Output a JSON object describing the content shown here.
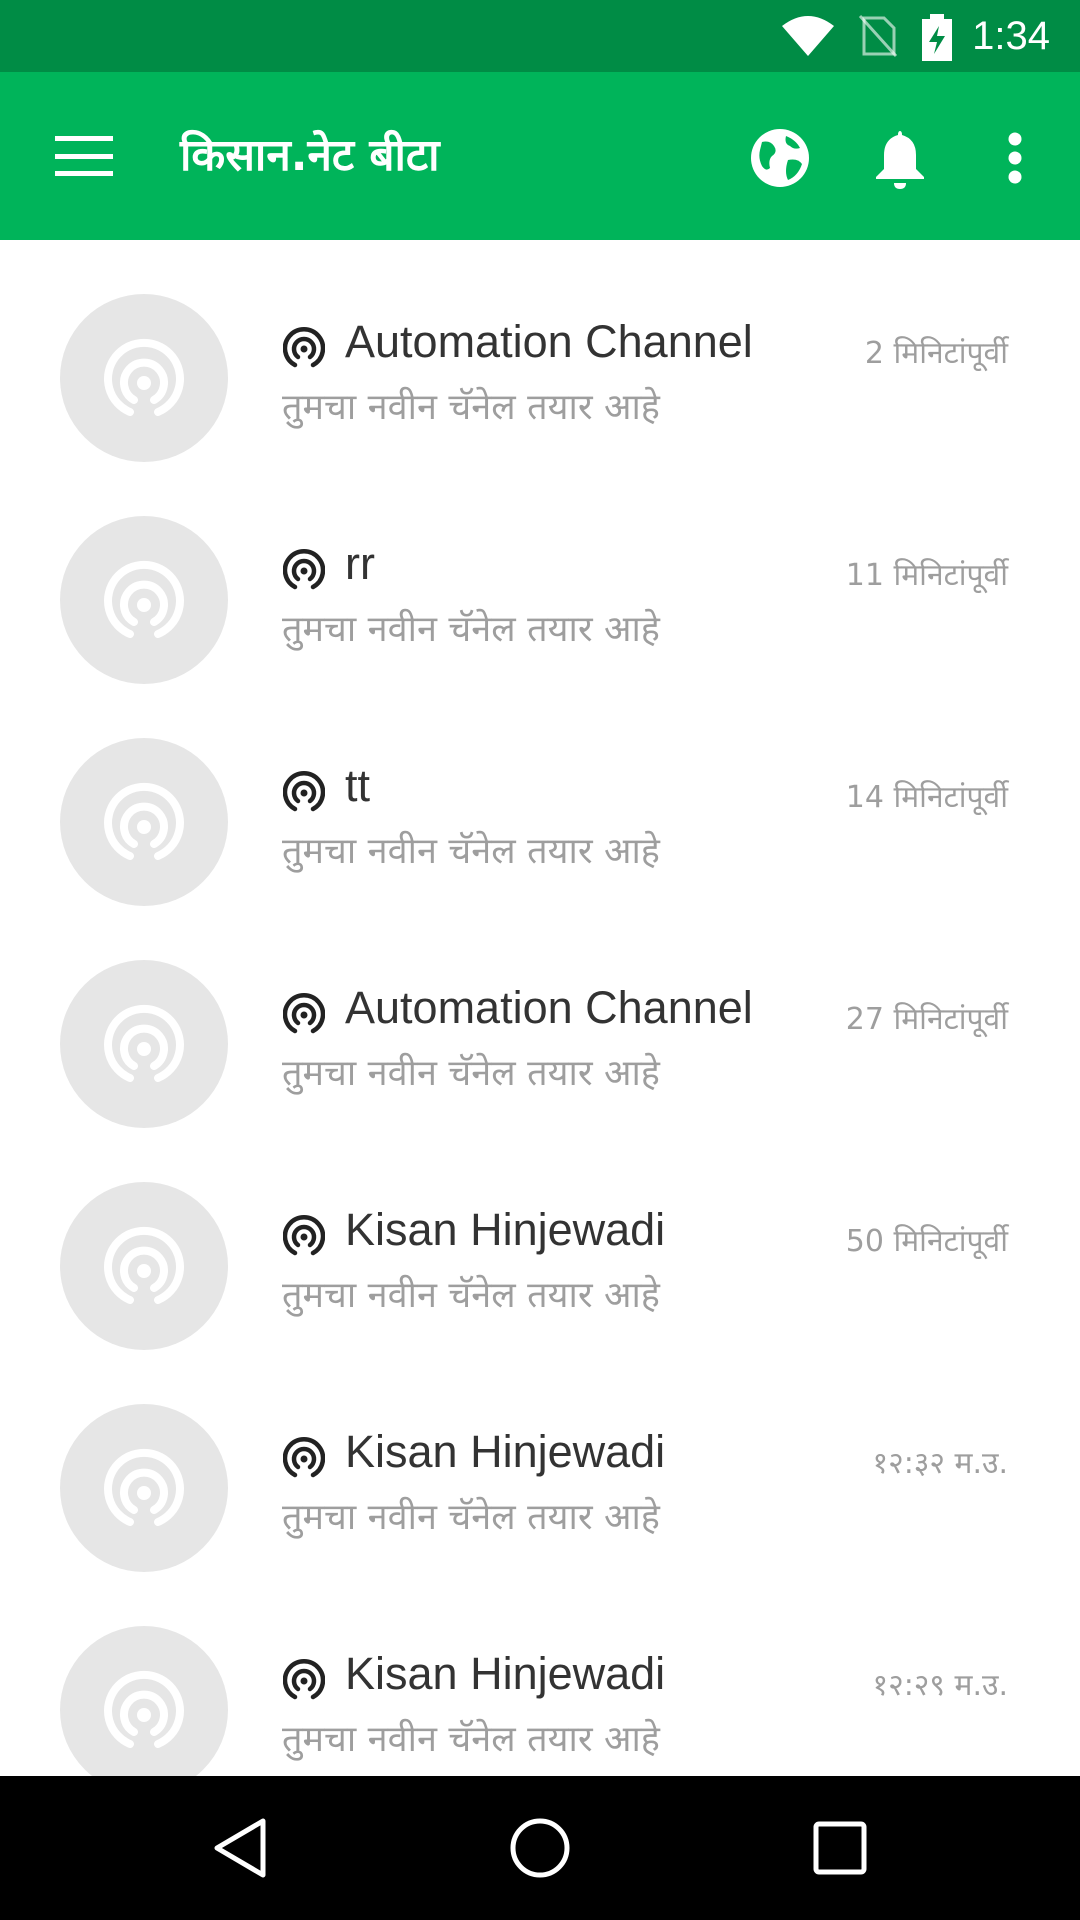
{
  "status_bar": {
    "time": "1:34",
    "icons": [
      "wifi-icon",
      "no-sim-icon",
      "battery-charging-icon"
    ]
  },
  "app_bar": {
    "title": "किसान.नेट बीटा",
    "icons": [
      "menu-icon",
      "globe-icon",
      "bell-icon",
      "more-vert-icon"
    ]
  },
  "channels": [
    {
      "name": "Automation Channel",
      "message": "तुमचा नवीन चॅनेल तयार आहे",
      "time": "2 मिनिटांपूर्वी"
    },
    {
      "name": "rr",
      "message": "तुमचा नवीन चॅनेल तयार आहे",
      "time": "11 मिनिटांपूर्वी"
    },
    {
      "name": "tt",
      "message": "तुमचा नवीन चॅनेल तयार आहे",
      "time": "14 मिनिटांपूर्वी"
    },
    {
      "name": "Automation Channel",
      "message": "तुमचा नवीन चॅनेल तयार आहे",
      "time": "27 मिनिटांपूर्वी"
    },
    {
      "name": "Kisan Hinjewadi",
      "message": "तुमचा नवीन चॅनेल तयार आहे",
      "time": "50 मिनिटांपूर्वी"
    },
    {
      "name": "Kisan Hinjewadi",
      "message": "तुमचा नवीन चॅनेल तयार आहे",
      "time": "१२:३२ म.उ."
    },
    {
      "name": "Kisan Hinjewadi",
      "message": "तुमचा नवीन चॅनेल तयार आहे",
      "time": "१२:२९ म.उ."
    }
  ],
  "nav_bar": {
    "icons": [
      "back-icon",
      "home-icon",
      "recents-icon"
    ]
  },
  "colors": {
    "status_bar": "#008c45",
    "app_bar": "#00b45a",
    "avatar_bg": "#e6e6e6",
    "secondary_text": "#9e9e9e"
  }
}
